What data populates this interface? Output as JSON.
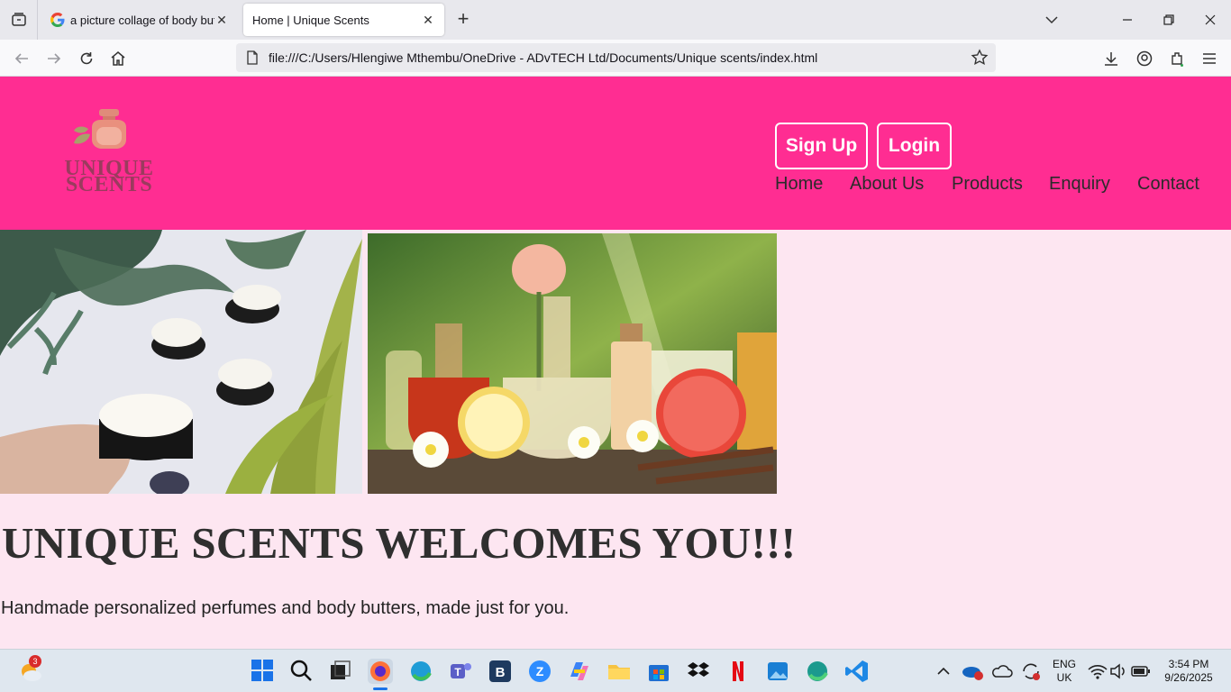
{
  "browser": {
    "tabs": [
      {
        "title": "a picture collage of body butter",
        "active": false
      },
      {
        "title": "Home | Unique Scents",
        "active": true
      }
    ],
    "url": "file:///C:/Users/Hlengiwe Mthembu/OneDrive - ADvTECH Ltd/Documents/Unique scents/index.html"
  },
  "header": {
    "logo": {
      "line1": "UNIQUE",
      "line2": "SCENTS"
    },
    "signup_label": "Sign Up",
    "login_label": "Login",
    "nav": [
      "Home",
      "About Us",
      "Products",
      "Enquiry",
      "Contact"
    ]
  },
  "main": {
    "heading": "UNIQUE SCENTS WELCOMES YOU!!!",
    "tagline": "Handmade personalized perfumes and body butters, made just for you."
  },
  "taskbar": {
    "notification_badge": "3",
    "language": {
      "line1": "ENG",
      "line2": "UK"
    },
    "time": "3:54 PM",
    "date": "9/26/2025"
  },
  "colors": {
    "header_bg": "#ff2d92",
    "page_bg": "#fde6f1"
  }
}
